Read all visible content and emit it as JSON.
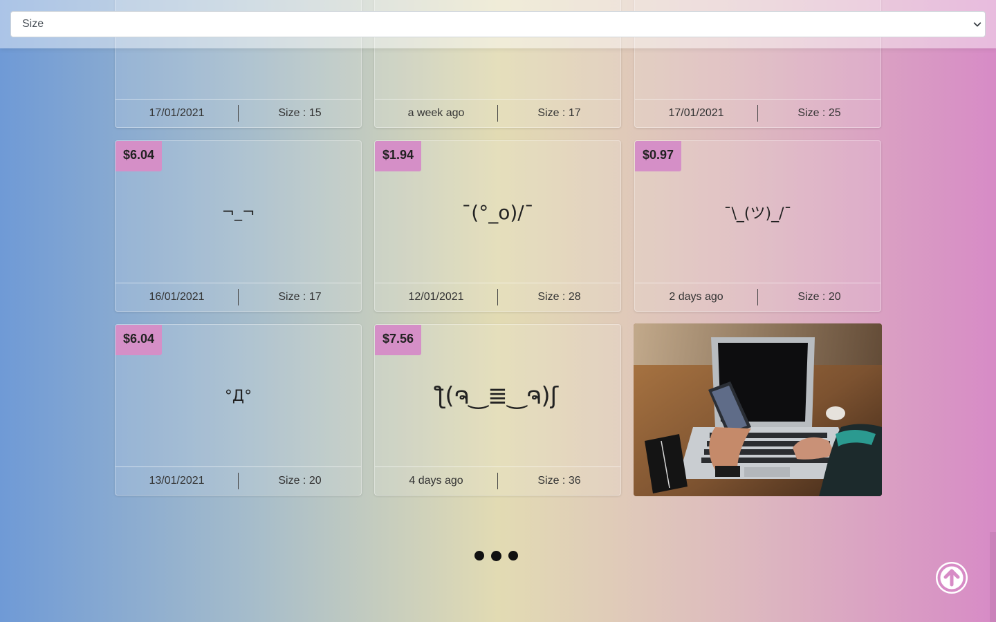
{
  "sort": {
    "selected": "Size"
  },
  "cards": [
    {
      "price": "",
      "face": "",
      "date": "17/01/2021",
      "size": "Size : 15"
    },
    {
      "price": "",
      "face": "",
      "date": "a week ago",
      "size": "Size : 17"
    },
    {
      "price": "",
      "face": "",
      "date": "17/01/2021",
      "size": "Size : 25"
    },
    {
      "price": "$6.04",
      "face": "¬_¬",
      "date": "16/01/2021",
      "size": "Size : 17"
    },
    {
      "price": "$1.94",
      "face": "¯(°_o)/¯",
      "date": "12/01/2021",
      "size": "Size : 28"
    },
    {
      "price": "$0.97",
      "face": "¯\\_(ツ)_/¯",
      "date": "2 days ago",
      "size": "Size : 20"
    },
    {
      "price": "$6.04",
      "face": "°Д°",
      "date": "13/01/2021",
      "size": "Size : 20"
    },
    {
      "price": "$7.56",
      "face": "ƪ(ຈ‿≣‿ຈ)ʃ",
      "date": "4 days ago",
      "size": "Size : 36"
    }
  ],
  "colors": {
    "price_badge": "#d58fc7",
    "scroll_top_button": "#d78bc6"
  },
  "icons": {
    "scroll_top": "arrow-up-circle-icon",
    "loading": "ellipsis-loading-icon",
    "select": "chevron-down-icon"
  }
}
